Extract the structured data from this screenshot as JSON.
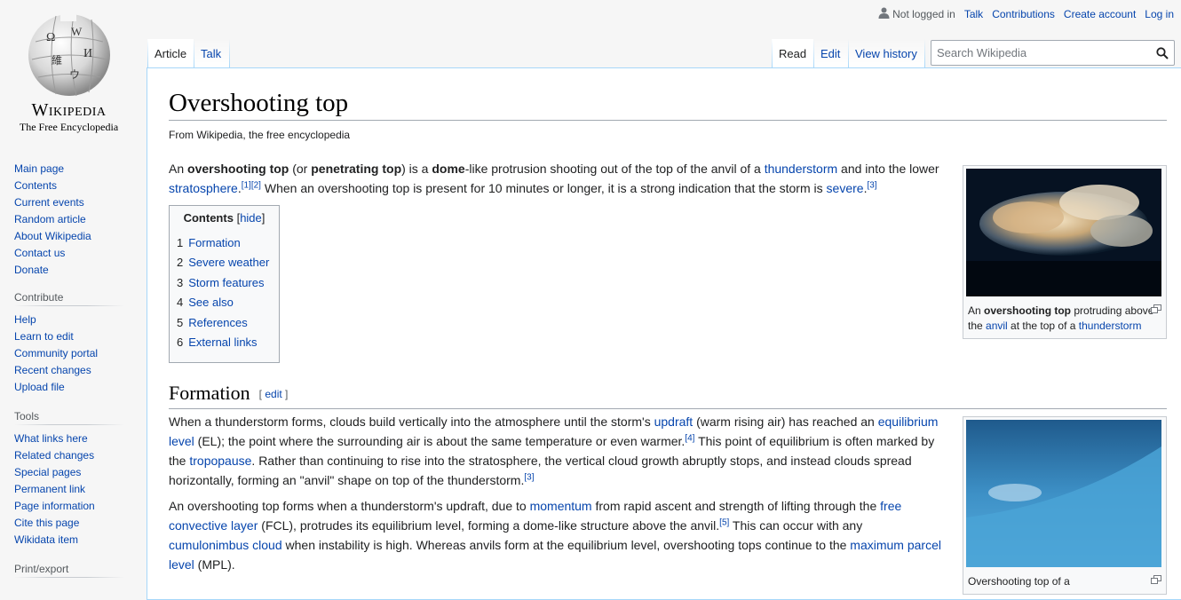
{
  "logo": {
    "wordmark": "Wikipedia",
    "tagline": "The Free Encyclopedia"
  },
  "personal": {
    "not_logged_in": "Not logged in",
    "talk": "Talk",
    "contributions": "Contributions",
    "create_account": "Create account",
    "log_in": "Log in"
  },
  "tabs": {
    "article": "Article",
    "talk": "Talk",
    "read": "Read",
    "edit": "Edit",
    "view_history": "View history"
  },
  "search": {
    "placeholder": "Search Wikipedia"
  },
  "sidebar": {
    "navigation": [
      "Main page",
      "Contents",
      "Current events",
      "Random article",
      "About Wikipedia",
      "Contact us",
      "Donate"
    ],
    "contribute": {
      "heading": "Contribute",
      "items": [
        "Help",
        "Learn to edit",
        "Community portal",
        "Recent changes",
        "Upload file"
      ]
    },
    "tools": {
      "heading": "Tools",
      "items": [
        "What links here",
        "Related changes",
        "Special pages",
        "Permanent link",
        "Page information",
        "Cite this page",
        "Wikidata item"
      ]
    },
    "print_export": {
      "heading": "Print/export"
    }
  },
  "article": {
    "title": "Overshooting top",
    "site_sub": "From Wikipedia, the free encyclopedia",
    "intro": {
      "t1": "An ",
      "b1": "overshooting top",
      "t2": " (or ",
      "b2": "penetrating top",
      "t3": ") is a ",
      "b3": "dome",
      "t4": "-like protrusion shooting out of the top of the anvil of a ",
      "l1": "thunderstorm",
      "t5": " and into the lower ",
      "l2": "stratosphere",
      "t6": ".",
      "ref1": "[1]",
      "ref2": "[2]",
      "t7": " When an overshooting top is present for 10 minutes or longer, it is a strong indication that the storm is ",
      "l3": "severe",
      "t8": ".",
      "ref3": "[3]"
    },
    "toc": {
      "title": "Contents",
      "hide": "hide",
      "items": [
        {
          "num": "1",
          "label": "Formation"
        },
        {
          "num": "2",
          "label": "Severe weather"
        },
        {
          "num": "3",
          "label": "Storm features"
        },
        {
          "num": "4",
          "label": "See also"
        },
        {
          "num": "5",
          "label": "References"
        },
        {
          "num": "6",
          "label": "External links"
        }
      ]
    },
    "formation": {
      "heading": "Formation",
      "edit": "edit",
      "p1": {
        "t1": "When a thunderstorm forms, clouds build vertically into the atmosphere until the storm's ",
        "l1": "updraft",
        "t2": " (warm rising air) has reached an ",
        "l2": "equilibrium level",
        "t3": " (EL); the point where the surrounding air is about the same temperature or even warmer.",
        "ref1": "[4]",
        "t4": " This point of equilibrium is often marked by the ",
        "l3": "tropopause",
        "t5": ". Rather than continuing to rise into the stratosphere, the vertical cloud growth abruptly stops, and instead clouds spread horizontally, forming an \"anvil\" shape on top of the thunderstorm.",
        "ref2": "[3]"
      },
      "p2": {
        "t1": "An overshooting top forms when a thunderstorm's updraft, due to ",
        "l1": "momentum",
        "t2": " from rapid ascent and strength of lifting through the ",
        "l2": "free convective layer",
        "t3": " (FCL), protrudes its equilibrium level, forming a dome-like structure above the anvil.",
        "ref1": "[5]",
        "t4": " This can occur with any ",
        "l3": "cumulonimbus cloud",
        "t5": " when instability is high. Whereas anvils form at the equilibrium level, overshooting tops continue to the ",
        "l4": "maximum parcel level",
        "t6": " (MPL)."
      }
    },
    "thumb1": {
      "c1": "An ",
      "b1": "overshooting top",
      "c2": " protruding above the ",
      "l1": "anvil",
      "c3": " at the top of a ",
      "l2": "thunderstorm"
    },
    "thumb2": {
      "caption": "Overshooting top of a"
    }
  }
}
